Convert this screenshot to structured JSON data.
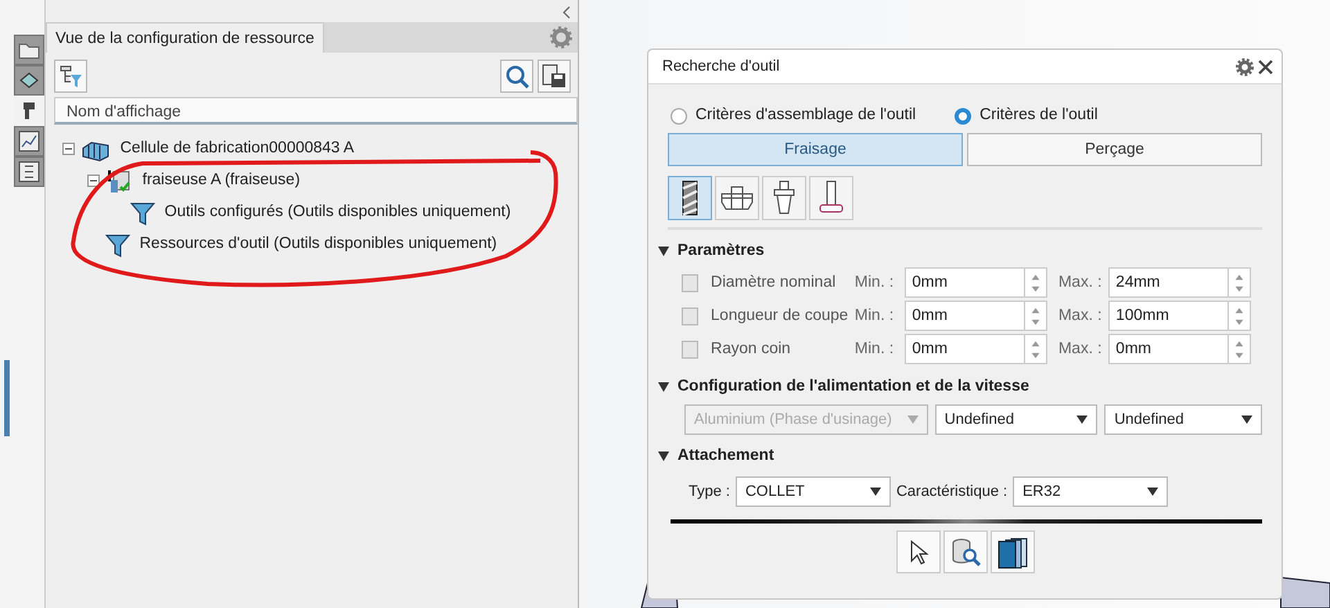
{
  "side_tabs": [
    {
      "kind": "folder",
      "selected": false
    },
    {
      "kind": "part",
      "selected": false
    },
    {
      "kind": "machine",
      "selected": true
    },
    {
      "kind": "chart",
      "selected": false
    },
    {
      "kind": "list",
      "selected": false
    }
  ],
  "panel": {
    "title": "Vue de la configuration de ressource",
    "column_header": "Nom d'affichage",
    "tree": [
      {
        "label": "Cellule de fabrication00000843 A",
        "kind": "cell",
        "expanded": true,
        "children": [
          {
            "label": "fraiseuse A (fraiseuse)",
            "kind": "machine",
            "expanded": true,
            "children": [
              {
                "label": "Outils configurés (Outils disponibles uniquement)",
                "kind": "filter"
              }
            ]
          },
          {
            "label": "Ressources d'outil (Outils disponibles uniquement)",
            "kind": "filter"
          }
        ]
      }
    ]
  },
  "dialog": {
    "title": "Recherche d'outil",
    "radios": [
      {
        "label": "Critères d'assemblage de l'outil",
        "selected": false
      },
      {
        "label": "Critères de l'outil",
        "selected": true
      }
    ],
    "tabs": [
      {
        "label": "Fraisage",
        "selected": true
      },
      {
        "label": "Perçage",
        "selected": false
      }
    ],
    "tool_types": [
      {
        "kind": "endmill",
        "selected": true
      },
      {
        "kind": "facemill",
        "selected": false
      },
      {
        "kind": "holder",
        "selected": false
      },
      {
        "kind": "tslot",
        "selected": false
      }
    ],
    "parameters": {
      "title": "Paramètres",
      "expanded": true,
      "rows": [
        {
          "label": "Diamètre nominal",
          "checked": false,
          "min_label": "Min. :",
          "min": "0mm",
          "max_label": "Max. :",
          "max": "24mm"
        },
        {
          "label": "Longueur de coupe",
          "checked": false,
          "min_label": "Min. :",
          "min": "0mm",
          "max_label": "Max. :",
          "max": "100mm"
        },
        {
          "label": "Rayon coin",
          "checked": false,
          "min_label": "Min. :",
          "min": "0mm",
          "max_label": "Max. :",
          "max": "0mm"
        }
      ]
    },
    "feed": {
      "title": "Configuration de l'alimentation et de la vitesse",
      "expanded": true,
      "selects": [
        {
          "value": "Aluminium (Phase d'usinage)",
          "disabled": true
        },
        {
          "value": "Undefined",
          "disabled": false
        },
        {
          "value": "Undefined",
          "disabled": false
        }
      ]
    },
    "attachment": {
      "title": "Attachement",
      "expanded": true,
      "type_label": "Type :",
      "type": "COLLET",
      "char_label": "Caractéristique :",
      "char": "ER32"
    },
    "actions": [
      {
        "kind": "pointer"
      },
      {
        "kind": "database-search"
      },
      {
        "kind": "library"
      }
    ]
  }
}
